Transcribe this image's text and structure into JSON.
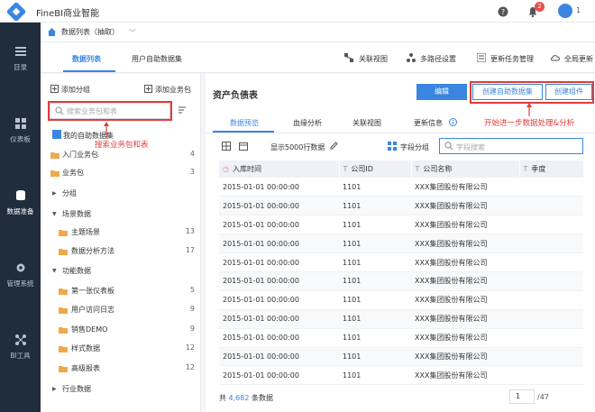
{
  "app": {
    "brand": "FineBI商业智能",
    "notif_count": "2",
    "user_label": "1"
  },
  "nav": [
    {
      "label": "目录"
    },
    {
      "label": "仪表板"
    },
    {
      "label": "数据准备"
    },
    {
      "label": "管理系统"
    },
    {
      "label": "BI工具"
    }
  ],
  "tab": {
    "main": "数据列表（抽取）",
    "chevron": "﹀"
  },
  "subtabs": {
    "list": "数据列表",
    "self": "用户自助数据集"
  },
  "tools": {
    "rel_view": "关联视图",
    "multi_path": "多路径设置",
    "update_mgmt": "更新任务管理",
    "global_update": "全局更新"
  },
  "left": {
    "add_group": "添加分组",
    "add_pkg": "添加业务包",
    "search_placeholder": "搜索业务包和表",
    "my_self": "我的自助数据集",
    "items": [
      {
        "label": "入门业务包",
        "count": "4"
      },
      {
        "label": "业务包",
        "count": "3"
      },
      {
        "label": "分组",
        "count": ""
      },
      {
        "label": "场景数据",
        "count": ""
      },
      {
        "label": "主题场景",
        "count": "13"
      },
      {
        "label": "数据分析方法",
        "count": "17"
      },
      {
        "label": "功能数据",
        "count": ""
      },
      {
        "label": "第一张仪表板",
        "count": "5"
      },
      {
        "label": "用户访问日志",
        "count": "9"
      },
      {
        "label": "销售DEMO",
        "count": "9"
      },
      {
        "label": "样式数据",
        "count": "12"
      },
      {
        "label": "高级报表",
        "count": "12"
      },
      {
        "label": "行业数据",
        "count": ""
      }
    ]
  },
  "annotations": {
    "search": "搜索业务包和表",
    "buttons": "开始进一步数据处理&分析"
  },
  "pane": {
    "title": "资产负债表",
    "edit": "编辑",
    "create_ds": "创建自助数据集",
    "create_comp": "创建组件",
    "tabs": {
      "preview": "数据预览",
      "lineage": "血缘分析",
      "relation": "关联视图",
      "update": "更新信息"
    },
    "show_rows": "显示5000行数据",
    "field_group": "字段分组",
    "field_search": "字段搜索"
  },
  "table": {
    "headers": [
      "入库时间",
      "公司ID",
      "公司名称",
      "季度"
    ],
    "rows": [
      [
        "2015-01-01 00:00:00",
        "1101",
        "XXX集团股份有限公司",
        ""
      ],
      [
        "2015-01-01 00:00:00",
        "1101",
        "XXX集团股份有限公司",
        ""
      ],
      [
        "2015-01-01 00:00:00",
        "1101",
        "XXX集团股份有限公司",
        ""
      ],
      [
        "2015-01-01 00:00:00",
        "1101",
        "XXX集团股份有限公司",
        ""
      ],
      [
        "2015-01-01 00:00:00",
        "1101",
        "XXX集团股份有限公司",
        ""
      ],
      [
        "2015-01-01 00:00:00",
        "1101",
        "XXX集团股份有限公司",
        ""
      ],
      [
        "2015-01-01 00:00:00",
        "1101",
        "XXX集团股份有限公司",
        ""
      ],
      [
        "2015-01-01 00:00:00",
        "1101",
        "XXX集团股份有限公司",
        ""
      ],
      [
        "2015-01-01 00:00:00",
        "1101",
        "XXX集团股份有限公司",
        ""
      ],
      [
        "2015-01-01 00:00:00",
        "1101",
        "XXX集团股份有限公司",
        ""
      ],
      [
        "2015-01-01 00:00:00",
        "1101",
        "XXX集团股份有限公司",
        ""
      ]
    ]
  },
  "footer": {
    "prefix": "共",
    "count": "4,682",
    "suffix": "条数据",
    "page": "1",
    "total_pages": "/47"
  },
  "colors": {
    "accent": "#3a86e0",
    "annotation": "#e23b3b",
    "nav_bg": "#1f2d3d"
  }
}
